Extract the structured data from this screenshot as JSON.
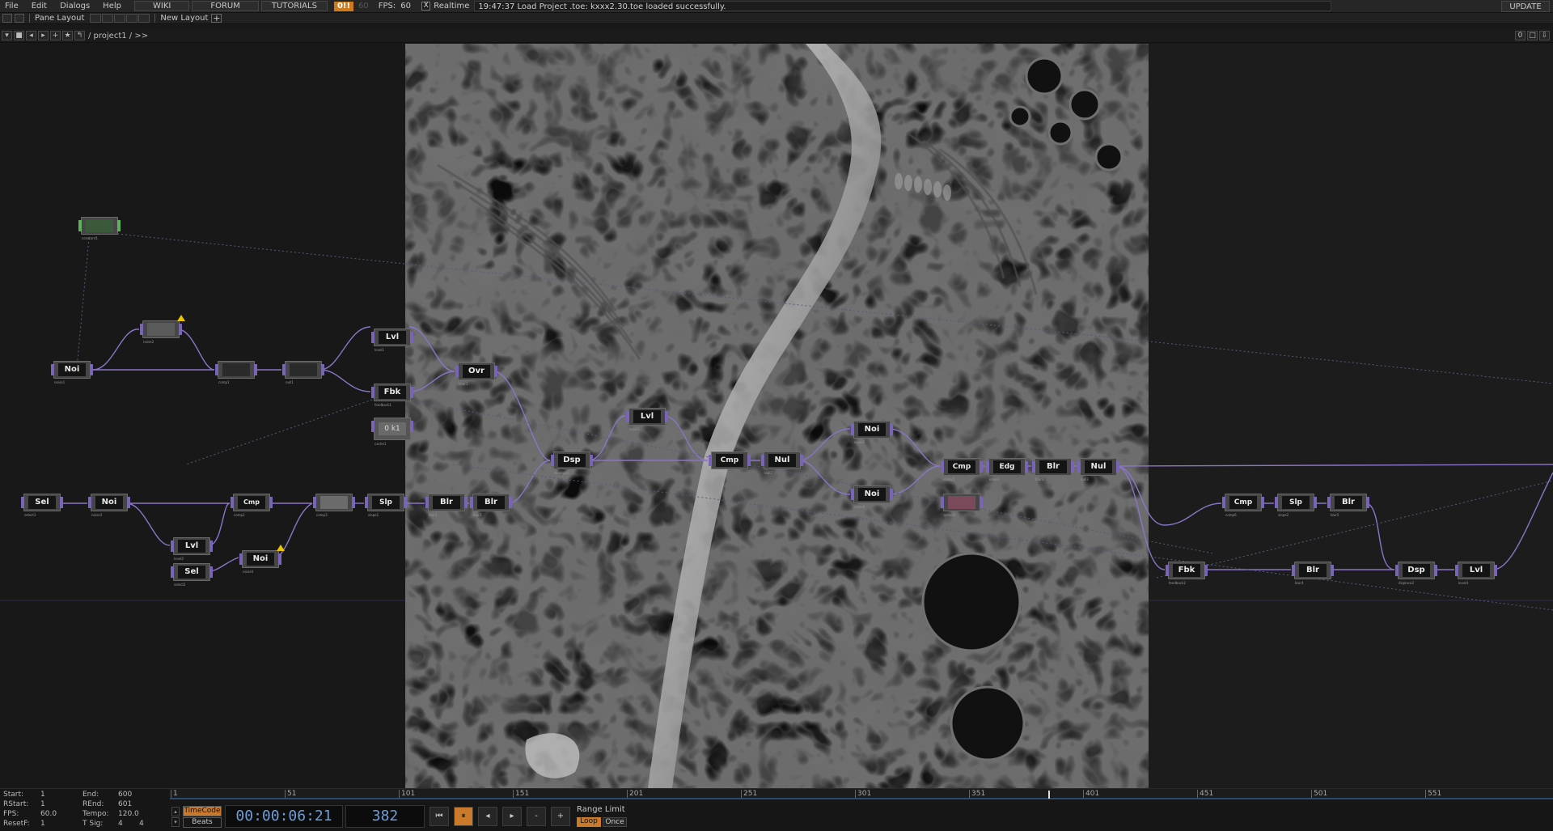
{
  "menubar": {
    "items": [
      "File",
      "Edit",
      "Dialogs",
      "Help"
    ],
    "wiki": "WIKI",
    "forum": "FORUM",
    "tutorials": "TUTORIALS",
    "perf": "0!!",
    "fps_dim": "60",
    "fps_label": "FPS:",
    "fps_value": "60",
    "realtime_check": "X",
    "realtime_label": "Realtime",
    "status": "19:47:37 Load Project .toe: kxxx2.30.toe loaded successfully.",
    "update": "UPDATE"
  },
  "toolbar": {
    "pane_layout": "Pane Layout",
    "new_layout": "New Layout",
    "plus": "+"
  },
  "pathbar": {
    "path": "/ project1 / >>",
    "right_count": "0"
  },
  "nodes": [
    {
      "id": "n_noise1",
      "label": "Noi",
      "sub": "noise1"
    },
    {
      "id": "n_thumb1",
      "label": "",
      "sub": "noise2",
      "warn": true
    },
    {
      "id": "n_thumb2",
      "label": "",
      "sub": "comp1"
    },
    {
      "id": "n_thumb3",
      "label": "",
      "sub": "null1"
    },
    {
      "id": "n_lvl1",
      "label": "Lvl",
      "sub": "level1"
    },
    {
      "id": "n_fbk1",
      "label": "Fbk",
      "sub": "feedback1"
    },
    {
      "id": "n_ovr1",
      "label": "Ovr",
      "sub": "over1"
    },
    {
      "id": "n_const",
      "label": "",
      "sub": "constant1"
    },
    {
      "id": "n_sel1",
      "label": "Sel",
      "sub": "select1"
    },
    {
      "id": "n_noi2",
      "label": "Noi",
      "sub": "noise3"
    },
    {
      "id": "n_cmp1",
      "label": "Cmp",
      "sub": "comp2"
    },
    {
      "id": "n_thumb4",
      "label": "",
      "sub": "comp3"
    },
    {
      "id": "n_slp1",
      "label": "Slp",
      "sub": "slope1"
    },
    {
      "id": "n_blr1",
      "label": "Blr",
      "sub": "blur1"
    },
    {
      "id": "n_blr2",
      "label": "Blr",
      "sub": "blur2"
    },
    {
      "id": "n_lvl2",
      "label": "Lvl",
      "sub": "level2"
    },
    {
      "id": "n_noi3",
      "label": "Noi",
      "sub": "noise4",
      "warn": true
    },
    {
      "id": "n_sel2",
      "label": "Sel",
      "sub": "select2"
    },
    {
      "id": "n_dsp1",
      "label": "Dsp",
      "sub": "displace1"
    },
    {
      "id": "n_lvl3",
      "label": "Lvl",
      "sub": "level3"
    },
    {
      "id": "n_cmp2",
      "label": "Cmp",
      "sub": "comp4"
    },
    {
      "id": "n_nul1",
      "label": "Nul",
      "sub": "null2"
    },
    {
      "id": "n_noi4",
      "label": "Noi",
      "sub": "noise5"
    },
    {
      "id": "n_noi5",
      "label": "Noi",
      "sub": "noise6"
    },
    {
      "id": "n_cmp3",
      "label": "Cmp",
      "sub": "comp5"
    },
    {
      "id": "n_edg",
      "label": "Edg",
      "sub": "edge1"
    },
    {
      "id": "n_blr3",
      "label": "Blr",
      "sub": "blur3"
    },
    {
      "id": "n_nul2",
      "label": "Nul",
      "sub": "null3"
    },
    {
      "id": "n_thumb5",
      "label": "",
      "sub": "select3"
    },
    {
      "id": "n_cmp4",
      "label": "Cmp",
      "sub": "comp6"
    },
    {
      "id": "n_slp2",
      "label": "Slp",
      "sub": "slope2"
    },
    {
      "id": "n_blr4",
      "label": "Blr",
      "sub": "blur5"
    },
    {
      "id": "n_fbk2",
      "label": "Fbk",
      "sub": "feedback2"
    },
    {
      "id": "n_blr5",
      "label": "Blr",
      "sub": "blur4"
    },
    {
      "id": "n_dsp2",
      "label": "Dsp",
      "sub": "displace2"
    },
    {
      "id": "n_lvl4",
      "label": "Lvl",
      "sub": "level4"
    },
    {
      "id": "n_cache",
      "label": "0 k1",
      "sub": "cache1"
    }
  ],
  "stats": {
    "start_label": "Start:",
    "start": "1",
    "end_label": "End:",
    "end": "600",
    "rstart_label": "RStart:",
    "rstart": "1",
    "rend_label": "REnd:",
    "rend": "601",
    "fps_label": "FPS:",
    "fps": "60.0",
    "tempo_label": "Tempo:",
    "tempo": "120.0",
    "resetf_label": "ResetF:",
    "resetf": "1",
    "tsig_label": "T Sig:",
    "tsig_a": "4",
    "tsig_b": "4"
  },
  "timeline": {
    "ticks": [
      "1",
      "51",
      "101",
      "151",
      "201",
      "251",
      "301",
      "351",
      "401",
      "451",
      "501",
      "551"
    ],
    "timecode_btn": "TimeCode",
    "beats_btn": "Beats",
    "timecode": "00:00:06:21",
    "frame": "382",
    "range_label": "Range Limit",
    "loop": "Loop",
    "once": "Once",
    "minus": "-",
    "plus": "+"
  }
}
